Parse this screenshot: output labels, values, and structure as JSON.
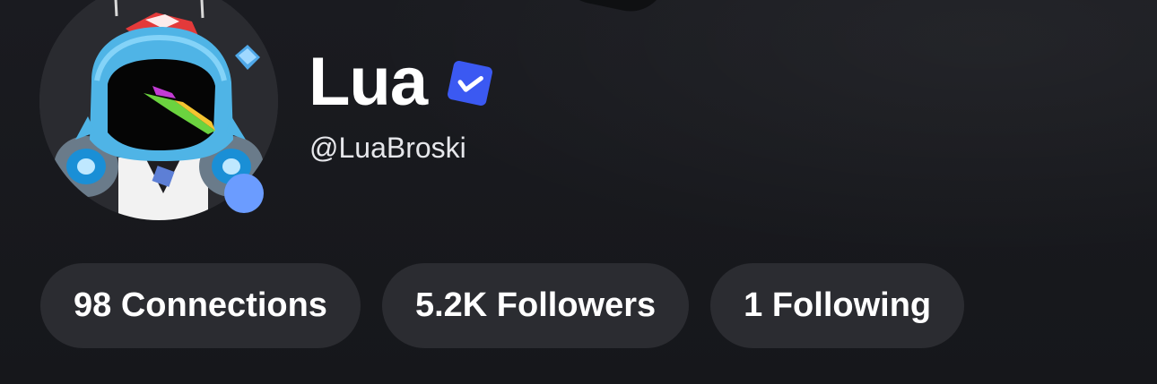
{
  "profile": {
    "display_name": "Lua",
    "username": "@LuaBroski",
    "verified_icon": "verified-check-icon",
    "online_status_color": "#6b9cff"
  },
  "stats": {
    "connections": "98 Connections",
    "followers": "5.2K Followers",
    "following": "1 Following"
  },
  "colors": {
    "background": "#17181c",
    "pill_background": "#2b2c31",
    "verified_badge": "#3b59f2",
    "text": "#ffffff"
  }
}
